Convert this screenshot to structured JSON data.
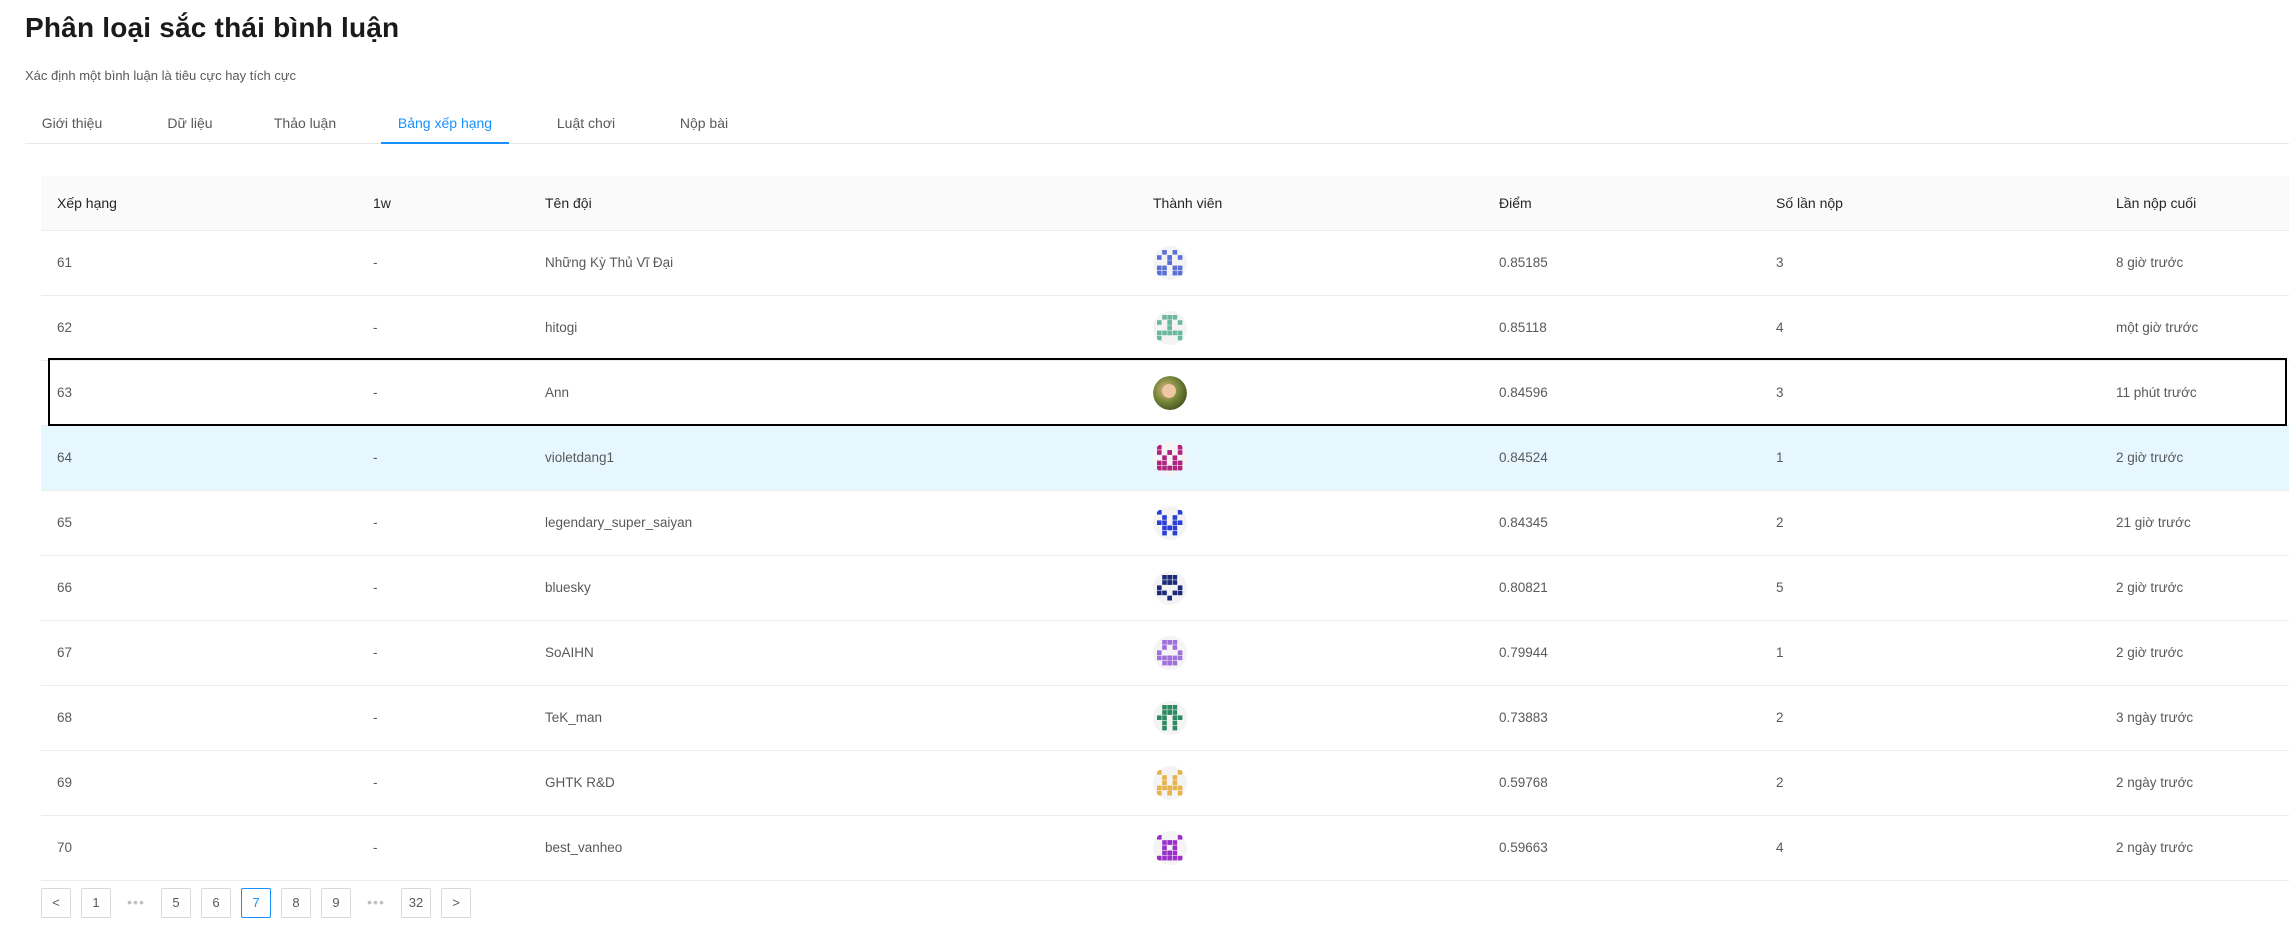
{
  "page": {
    "title": "Phân loại sắc thái bình luận",
    "subtitle": "Xác định một bình luận là tiêu cực hay tích cực"
  },
  "tabs": [
    {
      "label": "Giới thiệu"
    },
    {
      "label": "Dữ liệu"
    },
    {
      "label": "Thảo luận"
    },
    {
      "label": "Bảng xếp hạng",
      "active": true
    },
    {
      "label": "Luật chơi"
    },
    {
      "label": "Nộp bài"
    }
  ],
  "table": {
    "headers": {
      "rank": "Xếp hạng",
      "change": "1w",
      "team": "Tên đội",
      "members": "Thành viên",
      "score": "Điểm",
      "submissions": "Số lần nộp",
      "last": "Lần nộp cuối"
    },
    "rows": [
      {
        "rank": "61",
        "change": "-",
        "team": "Những Kỳ Thủ Vĩ Đại",
        "avatar": "identicon-blue",
        "score": "0.85185",
        "submissions": "3",
        "last": "8 giờ trước"
      },
      {
        "rank": "62",
        "change": "-",
        "team": "hitogi",
        "avatar": "identicon-teal",
        "score": "0.85118",
        "submissions": "4",
        "last": "một giờ trước"
      },
      {
        "rank": "63",
        "change": "-",
        "team": "Ann",
        "avatar": "photo-avatar",
        "score": "0.84596",
        "submissions": "3",
        "last": "11 phút trước"
      },
      {
        "rank": "64",
        "change": "-",
        "team": "violetdang1",
        "avatar": "identicon-magenta",
        "score": "0.84524",
        "submissions": "1",
        "last": "2 giờ trước"
      },
      {
        "rank": "65",
        "change": "-",
        "team": "legendary_super_saiyan",
        "avatar": "identicon-royal-blue",
        "score": "0.84345",
        "submissions": "2",
        "last": "21 giờ trước"
      },
      {
        "rank": "66",
        "change": "-",
        "team": "bluesky",
        "avatar": "identicon-navy",
        "score": "0.80821",
        "submissions": "5",
        "last": "2 giờ trước"
      },
      {
        "rank": "67",
        "change": "-",
        "team": "SoAIHN",
        "avatar": "identicon-lavender",
        "score": "0.79944",
        "submissions": "1",
        "last": "2 giờ trước"
      },
      {
        "rank": "68",
        "change": "-",
        "team": "TeK_man",
        "avatar": "identicon-green",
        "score": "0.73883",
        "submissions": "2",
        "last": "3 ngày trước"
      },
      {
        "rank": "69",
        "change": "-",
        "team": "GHTK R&D",
        "avatar": "identicon-gold",
        "score": "0.59768",
        "submissions": "2",
        "last": "2 ngày trước"
      },
      {
        "rank": "70",
        "change": "-",
        "team": "best_vanheo",
        "avatar": "identicon-purple",
        "score": "0.59663",
        "submissions": "4",
        "last": "2 ngày trước"
      }
    ]
  },
  "pagination": {
    "prev": "<",
    "next": ">",
    "ellipsis": "•••",
    "pages": [
      "1",
      "5",
      "6",
      "7",
      "8",
      "9",
      "32"
    ],
    "current": "7"
  },
  "colors": {
    "accent": "#1890ff",
    "row_hover": "#e6f7ff",
    "avatars": {
      "identicon-blue": "#5b6fd6",
      "identicon-teal": "#6ab8a0",
      "identicon-magenta": "#b0237e",
      "identicon-royal-blue": "#2a3fd8",
      "identicon-navy": "#1c2a7a",
      "identicon-lavender": "#a070dc",
      "identicon-green": "#2e8a64",
      "identicon-gold": "#e6b24a",
      "identicon-purple": "#9b2fc9"
    }
  }
}
